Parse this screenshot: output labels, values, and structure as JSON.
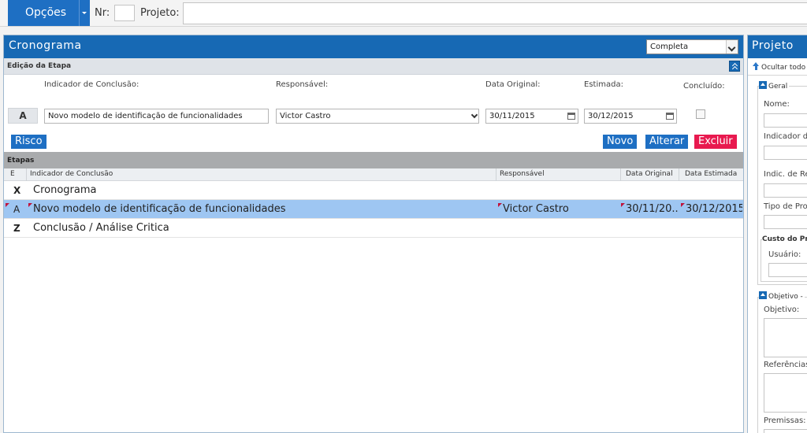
{
  "topbar": {
    "options_label": "Opções",
    "nr_label": "Nr:",
    "nr_value": "",
    "project_label": "Projeto:",
    "project_value": ""
  },
  "cronograma": {
    "title": "Cronograma",
    "view_select": "Completa",
    "edit_section_title": "Edição da Etapa",
    "form": {
      "etapa_letter": "A",
      "indicator_label": "Indicador de Conclusão:",
      "indicator_value": "Novo modelo de identificação de funcionalidades",
      "responsible_label": "Responsável:",
      "responsible_value": "Victor Castro",
      "original_date_label": "Data Original:",
      "original_date_value": "30/11/2015",
      "estimated_label": "Estimada:",
      "estimated_value": "30/12/2015",
      "done_label": "Concluído:"
    },
    "buttons": {
      "risco": "Risco",
      "novo": "Novo",
      "alterar": "Alterar",
      "excluir": "Excluir"
    },
    "etapas": {
      "title": "Etapas",
      "columns": [
        "E",
        "Indicador de Conclusão",
        "Responsável",
        "Data Original",
        "Data Estimada"
      ],
      "rows": [
        {
          "e": "X",
          "indicator": "Cronograma",
          "responsible": "",
          "original": "",
          "estimated": ""
        },
        {
          "e": "A",
          "indicator": "Novo modelo de identificação de funcionalidades",
          "responsible": "Victor Castro",
          "original": "30/11/20...",
          "estimated": "30/12/2015"
        },
        {
          "e": "Z",
          "indicator": "Conclusão / Análise Critica",
          "responsible": "",
          "original": "",
          "estimated": ""
        }
      ]
    }
  },
  "projeto": {
    "title": "Projeto",
    "hide_all": "Ocultar todo",
    "geral": {
      "legend": "Geral",
      "fields": [
        "Nome:",
        "Indicador d",
        "Indic. de Re",
        "Tipo de Proj"
      ]
    },
    "custo": {
      "title": "Custo do Pro",
      "user_label": "Usuário:"
    },
    "objetivo": {
      "legend": "Objetivo -",
      "fields": [
        "Objetivo:",
        "Referências",
        "Premissas:"
      ]
    }
  },
  "colors": {
    "header_blue": "#1769b4",
    "button_blue": "#1e6fc3",
    "button_red": "#e8194f",
    "selected_row": "#9ec6f2"
  }
}
